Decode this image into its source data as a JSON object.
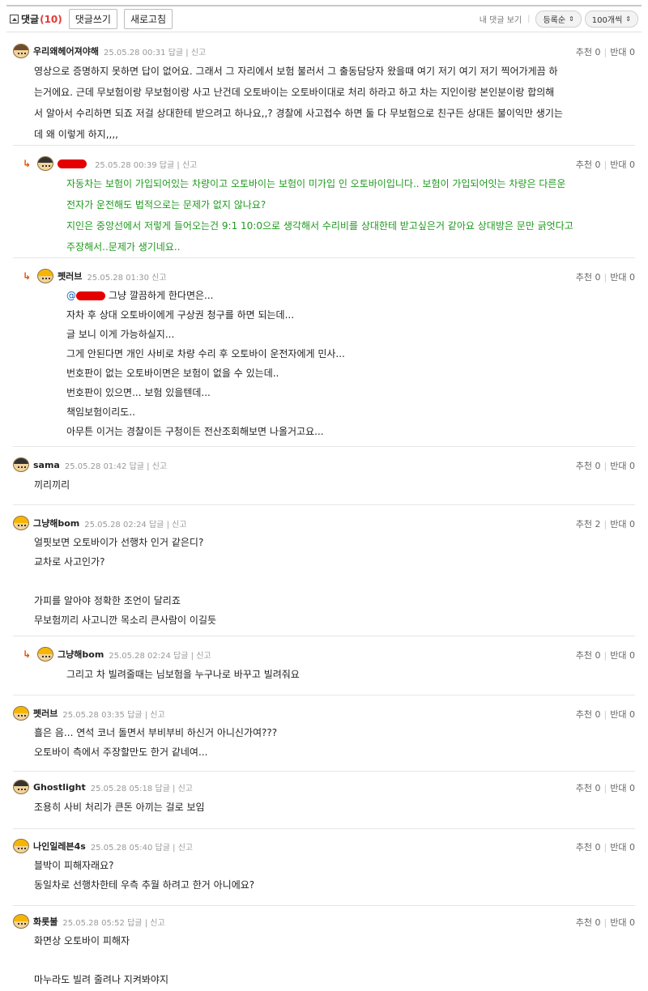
{
  "toolbar": {
    "comments_label": "댓글",
    "comments_count": "(10)",
    "write_button": "댓글쓰기",
    "refresh_button": "새로고침",
    "my_comments_label": "내 댓글 보기",
    "sort_select": "등록순",
    "page_size_select": "100개씩"
  },
  "common": {
    "reply_link": "답글",
    "report_link": "신고",
    "up_label": "추천",
    "down_label": "반대"
  },
  "comments": [
    {
      "nick": "우리왜헤어져야해",
      "time": "25.05.28 00:31",
      "up": "0",
      "down": "0",
      "body": "영상으로 증명하지 못하면 답이 없어요. 그래서 그 자리에서 보험 불러서 그 출동담당자 왔을때 여기 저기 여기 저기 찍어가게끔 하\n는거에요. 근데 무보험이랑 무보험이랑 사고 난건데 오토바이는 오토바이대로 처리 하라고 하고 차는 지인이랑 본인분이랑 합의해\n서 알아서 수리하면 되죠 저걸 상대한테 받으려고 하나요,,? 경찰에 사고접수 하면 둘 다 무보험으로 친구든 상대든 불이익만 생기는\n데 왜 이렇게 하지,,,,"
    },
    {
      "nick": "",
      "time": "25.05.28 00:39",
      "up": "0",
      "down": "0",
      "body": "자동차는 보험이 가입되어있는 차량이고 오토바이는 보험이 미가입 인 오토바이입니다.. 보험이 가입되어잇는 차량은 다른운\n전자가 운전해도 법적으로는 문제가 없지 않나요?\n지인은 중앙선에서 저렇게 들어오는건 9:1 10:0으로 생각해서 수리비를 상대한테 받고싶은거 같아요 상대방은 문만 긁엇다고\n주장해서..문제가 생기네요.."
    },
    {
      "nick": "펫러브",
      "time": "25.05.28 01:30",
      "up": "0",
      "down": "0",
      "mention": "@",
      "first_line": "그냥 깔끔하게 한다면은...",
      "body": "자차 후 상대 오토바이에게 구상권 청구를 하면 되는데...\n글 보니 이게 가능하실지...\n그게 안된다면 개인 사비로 차량 수리 후 오토바이 운전자에게 민사...\n번호판이 없는 오토바이면은 보험이 없을 수 있는데..\n번호판이 있으면... 보험 있을텐데...\n책임보험이리도..\n아무튼 이거는 경찰이든 구청이든 전산조회해보면 나올거고요..."
    },
    {
      "nick": "sama",
      "time": "25.05.28 01:42",
      "up": "0",
      "down": "0",
      "body": "끼리끼리"
    },
    {
      "nick": "그냥해bom",
      "time": "25.05.28 02:24",
      "up": "2",
      "down": "0",
      "body": "얼핏보면 오토바이가 선행차 인거 같은디?\n교차로 사고인가?\n\n가피를 알아야 정확한 조언이 달리죠\n무보험끼리 사고니깐 목소리 큰사람이 이길듯"
    },
    {
      "nick": "그냥해bom",
      "time": "25.05.28 02:24",
      "up": "0",
      "down": "0",
      "body": "그리고 차 빌려줄때는 님보험을 누구나로 바꾸고 빌려줘요"
    },
    {
      "nick": "펫러브",
      "time": "25.05.28 03:35",
      "up": "0",
      "down": "0",
      "body": "흘은 음... 연석 코너 돌면서 부비부비 하신거 아니신가여???\n오토바이 측에서 주장할만도 한거 같네여..."
    },
    {
      "nick": "Ghostlight",
      "time": "25.05.28 05:18",
      "up": "0",
      "down": "0",
      "body": "조용히 사비 처리가 큰돈 아끼는 걸로 보임"
    },
    {
      "nick": "나인일레븐4s",
      "time": "25.05.28 05:40",
      "up": "0",
      "down": "0",
      "body": "블박이 피해자래요?\n동일차로 선행차한테 우측 추월 하려고 한거 아니에요?"
    },
    {
      "nick": "화롯불",
      "time": "25.05.28 05:52",
      "up": "0",
      "down": "0",
      "body": "화면상 오토바이 피해자\n\n마누라도 빌려 줄려나 지켜봐야지"
    }
  ]
}
